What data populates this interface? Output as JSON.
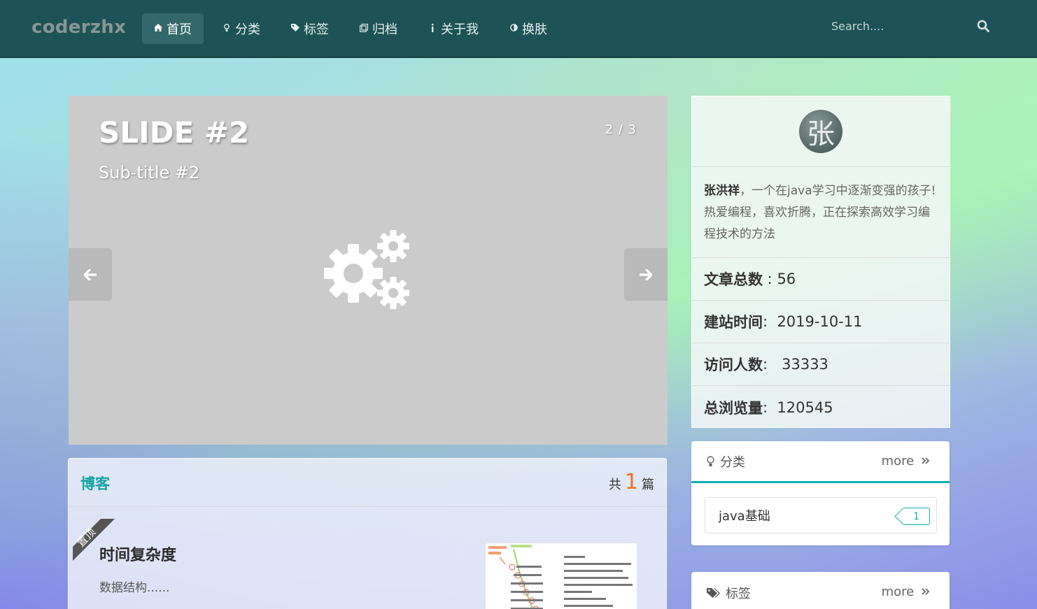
{
  "brand": "coderzhx",
  "nav": [
    {
      "icon": "home-icon",
      "label": "首页",
      "active": true
    },
    {
      "icon": "bulb-icon",
      "label": "分类"
    },
    {
      "icon": "tags-icon",
      "label": "标签"
    },
    {
      "icon": "archive-icon",
      "label": "归档"
    },
    {
      "icon": "info-icon",
      "label": "关于我"
    },
    {
      "icon": "theme-icon",
      "label": "换肤"
    }
  ],
  "search": {
    "placeholder": "Search...."
  },
  "carousel": {
    "title": "SLIDE #2",
    "subtitle": "Sub-title #2",
    "counter": "2 / 3"
  },
  "blog": {
    "heading": "博客",
    "count_prefix": "共",
    "count": "1",
    "count_suffix": "篇",
    "post": {
      "ribbon": "置顶",
      "title": "时间复杂度",
      "excerpt": "数据结构......"
    }
  },
  "profile": {
    "avatar_char": "张",
    "name": "张洪祥",
    "bio": "，一个在java学习中逐渐变强的孩子!热爱编程，喜欢折腾，正在探索高效学习编程技术的方法",
    "stats": [
      {
        "key": "文章总数",
        "sep": " : ",
        "value": "56"
      },
      {
        "key": "建站时间",
        "sep": ":  ",
        "value": "2019-10-11"
      },
      {
        "key": "访问人数",
        "sep": ":   ",
        "value": "33333"
      },
      {
        "key": "总浏览量",
        "sep": ":  ",
        "value": "120545"
      }
    ]
  },
  "category_card": {
    "title": "分类",
    "more": "more",
    "items": [
      {
        "label": "java基础",
        "count": "1"
      }
    ]
  },
  "tag_card": {
    "title": "标签",
    "more": "more"
  },
  "colors": {
    "navbar": "#1d5356",
    "accent": "#13aeb0",
    "count_orange": "#f07020"
  }
}
